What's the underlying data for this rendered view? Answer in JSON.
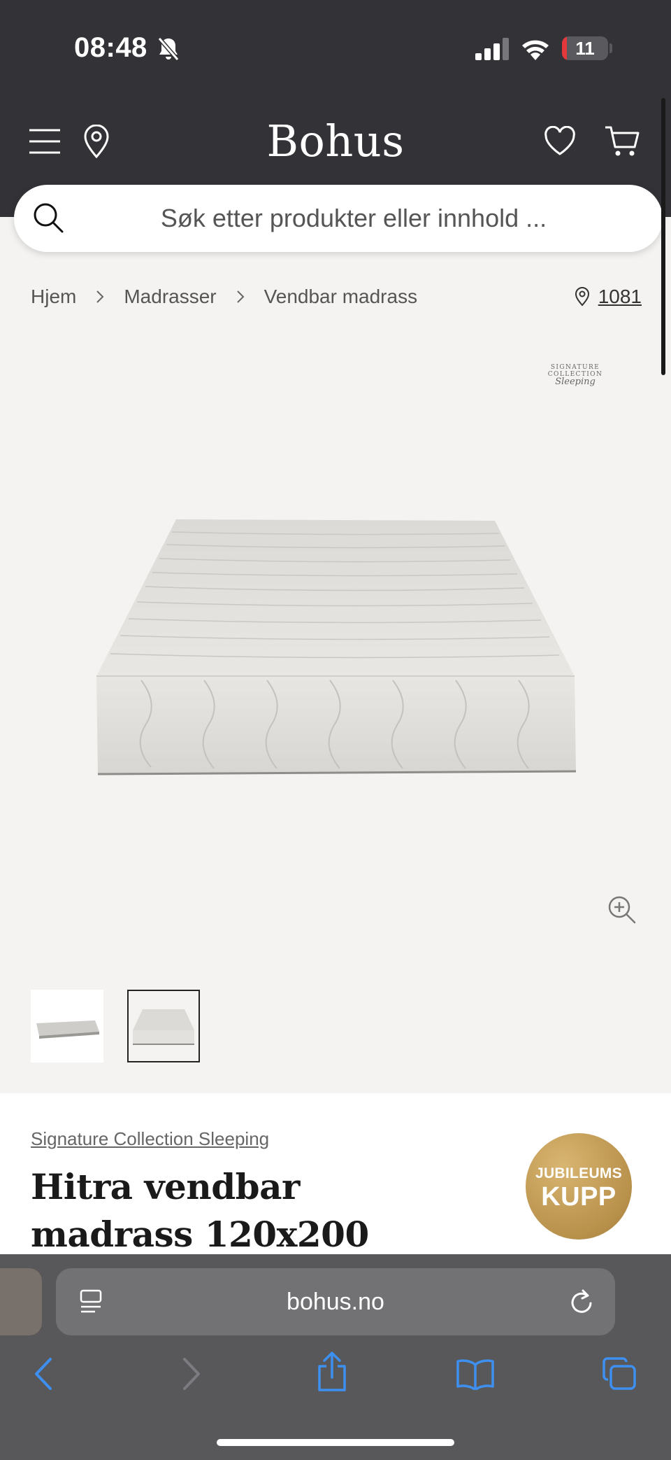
{
  "status": {
    "time": "08:48",
    "battery": "11",
    "battery_level": 0.11
  },
  "header": {
    "logo": "Bohus",
    "icons": [
      "menu-icon",
      "location-pin-icon",
      "heart-icon",
      "cart-icon"
    ]
  },
  "search": {
    "placeholder": "Søk etter produkter eller innhold ..."
  },
  "breadcrumb": {
    "items": [
      "Hjem",
      "Madrasser",
      "Vendbar madrass"
    ],
    "store_number": "1081"
  },
  "gallery": {
    "signature_logo_line1": "SIGNATURE COLLECTION",
    "signature_logo_line2": "Sleeping",
    "thumbnails": 2,
    "selected_thumbnail": 2
  },
  "product": {
    "brand": "Signature Collection Sleeping",
    "title": "Hitra vendbar madrass 120x200",
    "badge_line1": "JUBILEUMS",
    "badge_line2": "KUPP"
  },
  "browser": {
    "url": "bohus.no",
    "accent": "#3d8ff0"
  }
}
